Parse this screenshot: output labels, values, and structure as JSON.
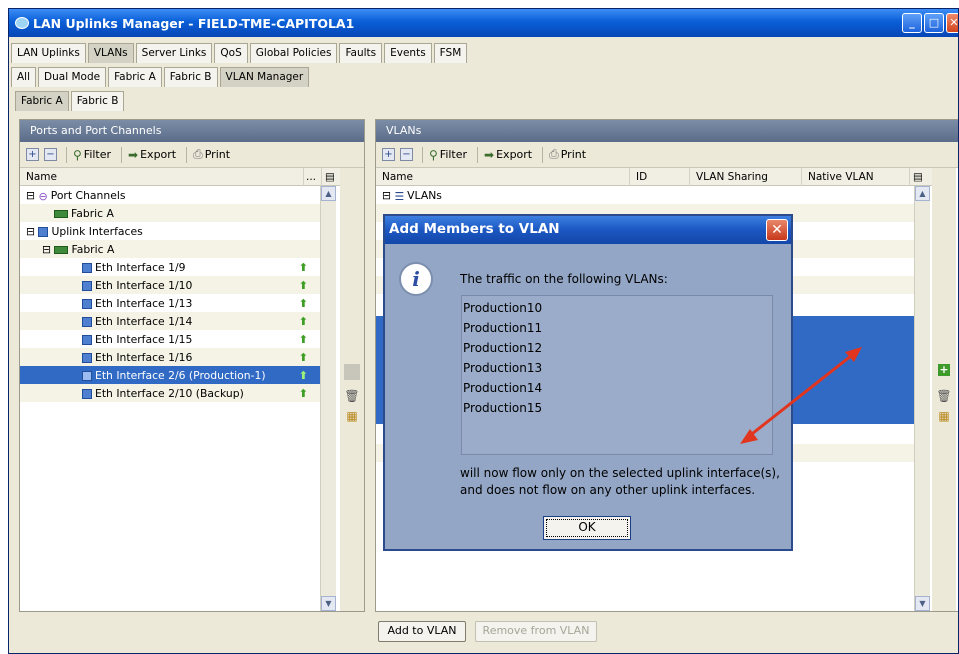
{
  "window": {
    "title": "LAN Uplinks Manager - FIELD-TME-CAPITOLA1"
  },
  "main_tabs": [
    "LAN Uplinks",
    "VLANs",
    "Server Links",
    "QoS",
    "Global Policies",
    "Faults",
    "Events",
    "FSM"
  ],
  "sub_tabs": [
    "All",
    "Dual Mode",
    "Fabric A",
    "Fabric B",
    "VLAN Manager"
  ],
  "fabric_tabs": [
    "Fabric A",
    "Fabric B"
  ],
  "toolbar": {
    "filter": "Filter",
    "export": "Export",
    "print": "Print"
  },
  "left_panel": {
    "title": "Ports and Port Channels",
    "column": "Name",
    "col_more": "...",
    "rows": [
      {
        "label": "Port Channels"
      },
      {
        "label": "Fabric A"
      },
      {
        "label": "Uplink Interfaces"
      },
      {
        "label": "Fabric A"
      },
      {
        "label": "Eth Interface 1/9"
      },
      {
        "label": "Eth Interface 1/10"
      },
      {
        "label": "Eth Interface 1/13"
      },
      {
        "label": "Eth Interface 1/14"
      },
      {
        "label": "Eth Interface 1/15"
      },
      {
        "label": "Eth Interface 1/16"
      },
      {
        "label": "Eth Interface 2/6 (Production-1)"
      },
      {
        "label": "Eth Interface 2/10 (Backup)"
      }
    ]
  },
  "right_panel": {
    "title": "VLANs",
    "columns": [
      "Name",
      "ID",
      "VLAN Sharing",
      "Native VLAN"
    ],
    "root": "VLANs"
  },
  "dialog": {
    "title": "Add Members to VLAN",
    "message_top": "The traffic on the following VLANs:",
    "vlans": [
      "Production10",
      "Production11",
      "Production12",
      "Production13",
      "Production14",
      "Production15"
    ],
    "message_bottom": "will now flow only on the selected uplink interface(s), and does not flow on any other uplink interfaces.",
    "ok": "OK"
  },
  "bottom": {
    "add": "Add to VLAN",
    "remove": "Remove from VLAN"
  },
  "colors": {
    "selection": "#316ac5",
    "arrow": "#e2351f",
    "titlebar": "#0a5fd8"
  }
}
